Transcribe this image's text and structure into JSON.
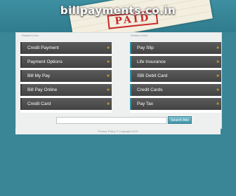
{
  "header": {
    "site_title": "billpayments.co.in",
    "stamp_text": "PAID"
  },
  "left_column": {
    "title": "Related Links",
    "items": [
      {
        "label": "Credit Payment"
      },
      {
        "label": "Payment Options"
      },
      {
        "label": "Bill My Pay"
      },
      {
        "label": "Bill Pay Online"
      },
      {
        "label": "Credit Card"
      }
    ]
  },
  "right_column": {
    "title": "Related Links",
    "items": [
      {
        "label": "Pay Slip"
      },
      {
        "label": "Life Insurance"
      },
      {
        "label": "SBI Debit Card"
      },
      {
        "label": "Credit Cards"
      },
      {
        "label": "Pay Tax"
      }
    ]
  },
  "search": {
    "placeholder": "",
    "button_label": "Search Ads"
  },
  "footer": {
    "text": "Privacy Policy © Copyright 2012"
  },
  "icons": {
    "chevron": "double-chevron-right-icon"
  },
  "colors": {
    "background": "#3a8596",
    "link_bg": "#4e4e4e",
    "chevron": "#f2b825",
    "stamp": "#c9272a"
  }
}
